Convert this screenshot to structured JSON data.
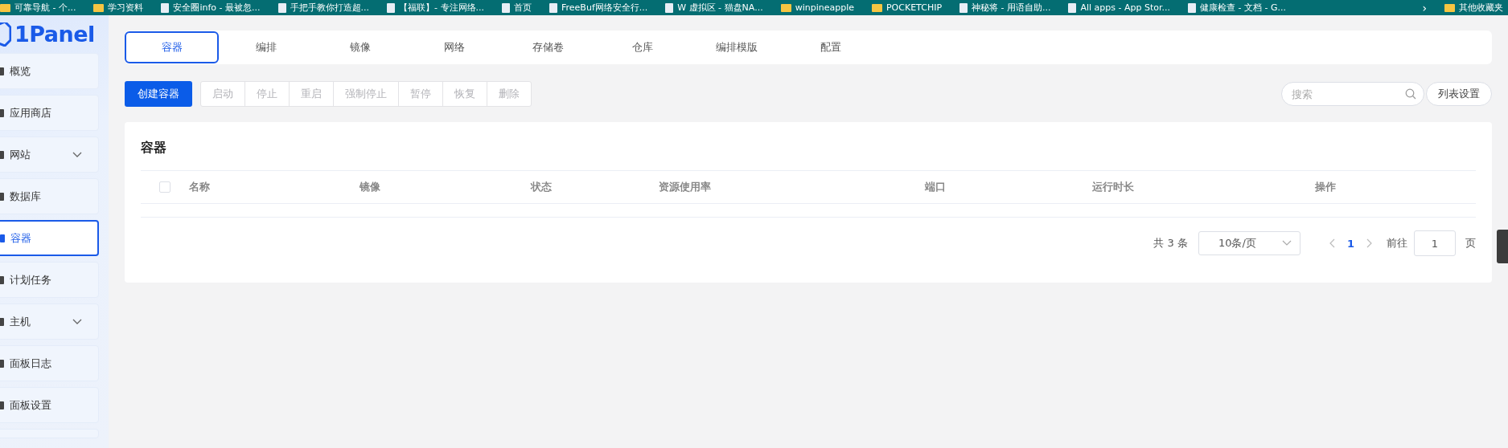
{
  "bookmarks": [
    {
      "label": "可靠导航 - 个...",
      "kind": "folder"
    },
    {
      "label": "学习资料",
      "kind": "folder"
    },
    {
      "label": "安全圈info - 最被忽...",
      "kind": "page"
    },
    {
      "label": "手把手教你打造超...",
      "kind": "page"
    },
    {
      "label": "【福联】- 专注网络...",
      "kind": "page"
    },
    {
      "label": "首页",
      "kind": "page"
    },
    {
      "label": "FreeBuf网络安全行...",
      "kind": "page"
    },
    {
      "label": "W 虚拟区 - 猫盘NA...",
      "kind": "page"
    },
    {
      "label": "winpineapple",
      "kind": "folder"
    },
    {
      "label": "POCKETCHIP",
      "kind": "folder"
    },
    {
      "label": "神秘将 - 用语自助...",
      "kind": "page"
    },
    {
      "label": "All apps - App Stor...",
      "kind": "page"
    },
    {
      "label": "健康检查 - 文档 - G...",
      "kind": "page"
    }
  ],
  "bookmarks_overflow": "›",
  "other_bookmarks": "其他收藏夹",
  "sidebar": {
    "logo": "1Panel",
    "items": [
      {
        "label": "概览",
        "selected": false,
        "expandable": false
      },
      {
        "label": "应用商店",
        "selected": false,
        "expandable": false
      },
      {
        "label": "网站",
        "selected": false,
        "expandable": true
      },
      {
        "label": "数据库",
        "selected": false,
        "expandable": false
      },
      {
        "label": "容器",
        "selected": true,
        "expandable": false
      },
      {
        "label": "计划任务",
        "selected": false,
        "expandable": false
      },
      {
        "label": "主机",
        "selected": false,
        "expandable": true
      },
      {
        "label": "面板日志",
        "selected": false,
        "expandable": false
      },
      {
        "label": "面板设置",
        "selected": false,
        "expandable": false
      }
    ]
  },
  "tabs": [
    {
      "label": "容器",
      "selected": true
    },
    {
      "label": "编排",
      "selected": false
    },
    {
      "label": "镜像",
      "selected": false
    },
    {
      "label": "网络",
      "selected": false
    },
    {
      "label": "存储卷",
      "selected": false
    },
    {
      "label": "仓库",
      "selected": false
    },
    {
      "label": "编排模版",
      "selected": false
    },
    {
      "label": "配置",
      "selected": false
    }
  ],
  "toolbar": {
    "create_button": "创建容器",
    "actions": [
      {
        "label": "启动",
        "disabled": true
      },
      {
        "label": "停止",
        "disabled": true
      },
      {
        "label": "重启",
        "disabled": true
      },
      {
        "label": "强制停止",
        "disabled": true
      },
      {
        "label": "暂停",
        "disabled": true
      },
      {
        "label": "恢复",
        "disabled": true
      },
      {
        "label": "删除",
        "disabled": true
      }
    ],
    "search": {
      "placeholder": "搜索"
    },
    "settings_button": "列表设置"
  },
  "table": {
    "title": "容器",
    "select_all_checked": false,
    "columns": [
      "名称",
      "镜像",
      "状态",
      "资源使用率",
      "端口",
      "运行时长",
      "操作"
    ]
  },
  "pagination": {
    "total": "共 3 条",
    "page_size": "10条/页",
    "pages": [
      {
        "label": "1",
        "selected": true
      }
    ],
    "goto_label": "前往",
    "goto_value": "1",
    "page_unit": "页"
  }
}
